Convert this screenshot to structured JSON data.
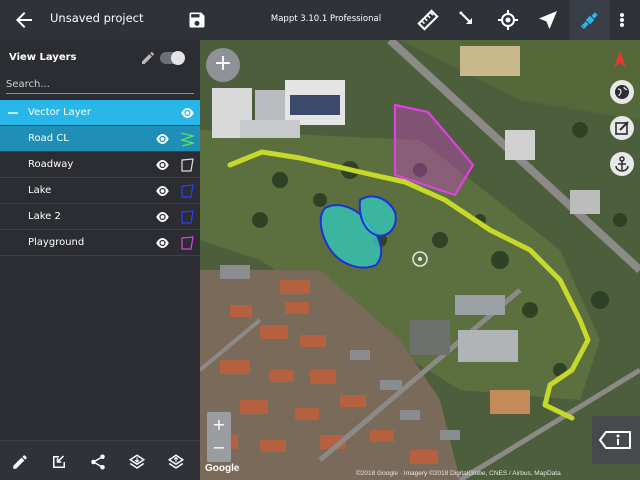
{
  "topbar": {
    "project_title": "Unsaved project",
    "app_title": "Mappt 3.10.1 Professional",
    "icons": [
      "back-arrow-icon",
      "save-icon",
      "ruler-icon",
      "pointer-tool-icon",
      "gps-target-icon",
      "navigation-icon",
      "satellite-icon",
      "more-menu-icon"
    ]
  },
  "panel": {
    "title": "View Layers",
    "search_placeholder": "Search...",
    "layers": [
      {
        "name": "Vector Layer",
        "kind": "group"
      },
      {
        "name": "Road CL",
        "kind": "line",
        "color": "#5de05d"
      },
      {
        "name": "Roadway",
        "kind": "polygon",
        "color": "#dddddd"
      },
      {
        "name": "Lake",
        "kind": "polygon",
        "color": "#2a3cff"
      },
      {
        "name": "Lake 2",
        "kind": "polygon",
        "color": "#2a3cff"
      },
      {
        "name": "Playground",
        "kind": "polygon",
        "color": "#e040e0"
      }
    ],
    "bottom_icons": [
      "edit-icon",
      "import-icon",
      "share-icon",
      "layers-down-icon",
      "layers-up-icon"
    ]
  },
  "map": {
    "add_label": "+",
    "zoom_in": "+",
    "zoom_out": "−",
    "google_logo": "Google",
    "attribution": "©2018 Google · Imagery ©2018 DigitalGlobe, CNES / Airbus, MapData",
    "colors": {
      "road": "#c6d82a",
      "playground": "#e040e0",
      "lake_fill": "#36c2b0",
      "lake_stroke": "#1f2fd8"
    }
  }
}
